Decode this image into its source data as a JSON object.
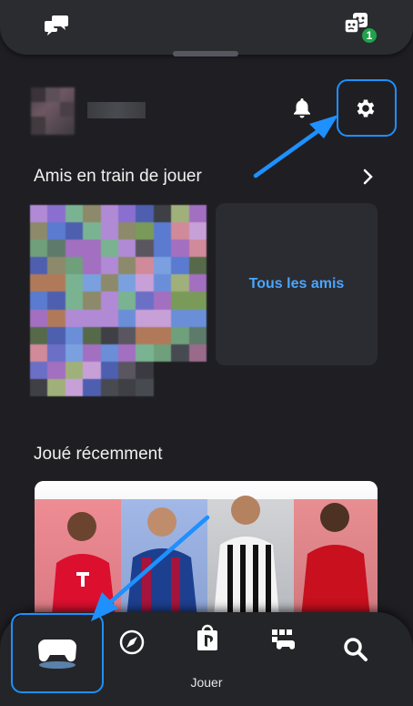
{
  "header": {
    "left_icon": "chat-bubbles-icon",
    "right_icon": "party-masks-icon",
    "badge_count": "1"
  },
  "profile": {
    "notification_icon": "bell-icon",
    "settings_icon": "gear-icon"
  },
  "friends_section": {
    "title": "Amis en train de jouer",
    "all_friends_label": "Tous les amis"
  },
  "recent_section": {
    "title": "Joué récemment"
  },
  "bottom_nav": {
    "items": [
      {
        "icon": "gamepad-icon",
        "label": "Jouer",
        "active": true
      },
      {
        "icon": "explore-compass-icon"
      },
      {
        "icon": "ps-store-icon"
      },
      {
        "icon": "game-library-icon"
      },
      {
        "icon": "search-icon"
      }
    ],
    "active_label": "Jouer"
  },
  "colors": {
    "accent": "#1e90ff",
    "link": "#4aa6ff",
    "background": "#1f1f23",
    "badge": "#1fa34a"
  }
}
